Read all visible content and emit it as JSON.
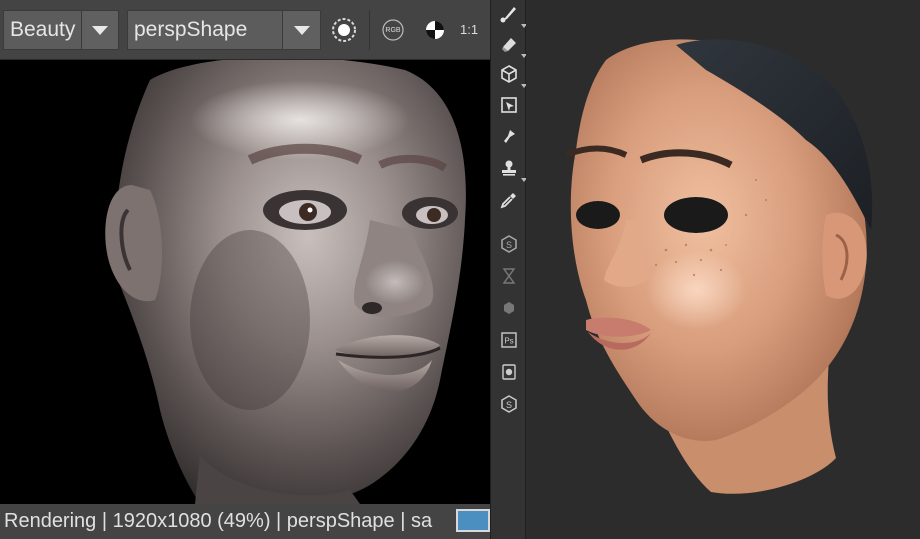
{
  "render_view": {
    "aov_value": "Beauty",
    "camera_value": "perspShape",
    "ratio_label": "1:1",
    "rgb_label": "RGB",
    "status_text": "Rendering | 1920x1080 (49%) | perspShape | sa"
  },
  "toolbar_icons": [
    "brush-icon",
    "eraser-icon",
    "cube-icon",
    "projection-icon",
    "smudge-icon",
    "stamp-icon",
    "eyedropper-icon",
    "substance-icon",
    "hourglass-icon",
    "substance-small-icon",
    "photoshop-icon",
    "material-icon",
    "substance-alt-icon"
  ],
  "colors": {
    "toolbar_bg": "#444444",
    "status_swatch": "#4a8fc0",
    "viewport_bg": "#2c2c2c"
  }
}
